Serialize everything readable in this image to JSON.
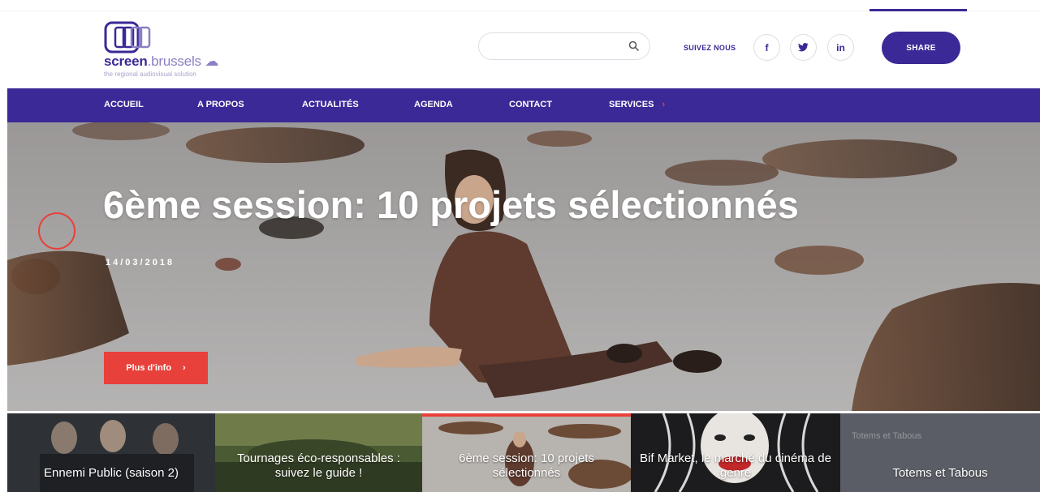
{
  "brand": {
    "name_bold": "screen",
    "name_rest": ".brussels",
    "tagline": "the regional audiovisual solution",
    "primary_color": "#3a2996",
    "accent_color": "#e8403a"
  },
  "header": {
    "search_placeholder": "",
    "follow_label": "SUIVEZ NOUS",
    "social": {
      "facebook": "f",
      "twitter": "✦",
      "linkedin": "in"
    },
    "share_label": "SHARE"
  },
  "nav": {
    "items": [
      {
        "label": "ACCUEIL"
      },
      {
        "label": "A PROPOS"
      },
      {
        "label": "ACTUALITÉS"
      },
      {
        "label": "AGENDA"
      },
      {
        "label": "CONTACT"
      },
      {
        "label": "SERVICES"
      }
    ],
    "chevron": "›"
  },
  "hero": {
    "title": "6ème session: 10 projets sélectionnés",
    "date": "14/03/2018",
    "button_label": "Plus d'info",
    "button_chevron": "›"
  },
  "thumbnails": [
    {
      "label": "Ennemi Public (saison 2)",
      "bg": "#2e3236"
    },
    {
      "label": "Tournages éco-responsables : suivez le guide !",
      "bg": "#4a5a33"
    },
    {
      "label": "6ème session: 10 projets sélectionnés",
      "bg": "#b7b3ae",
      "active": true
    },
    {
      "label": "Bif Market, le marché du cinéma de genre",
      "bg": "#1c1c1e"
    },
    {
      "label": "Totems et Tabous",
      "small": "Totems et Tabous",
      "bg": "#5b5d66"
    }
  ]
}
